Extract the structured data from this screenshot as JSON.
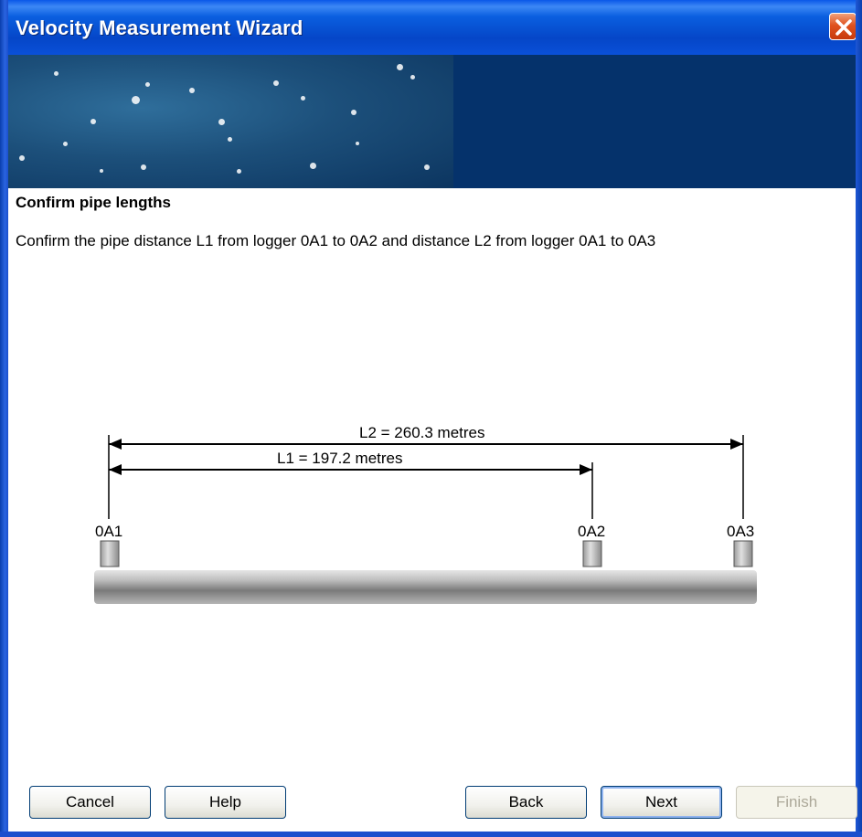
{
  "window": {
    "title": "Velocity Measurement Wizard"
  },
  "page": {
    "heading": "Confirm pipe lengths",
    "instructions": "Confirm the pipe distance L1  from logger 0A1 to 0A2 and distance L2 from logger 0A1 to 0A3"
  },
  "diagram": {
    "l2_label": "L2 = 260.3 metres",
    "l1_label": "L1 = 197.2 metres",
    "loggers": [
      "0A1",
      "0A2",
      "0A3"
    ]
  },
  "buttons": {
    "cancel": "Cancel",
    "help": "Help",
    "back": "Back",
    "next": "Next",
    "finish": "Finish"
  },
  "colors": {
    "titlebar": "#0546c8",
    "banner": "#05326b",
    "disabled_text": "#aca899"
  }
}
